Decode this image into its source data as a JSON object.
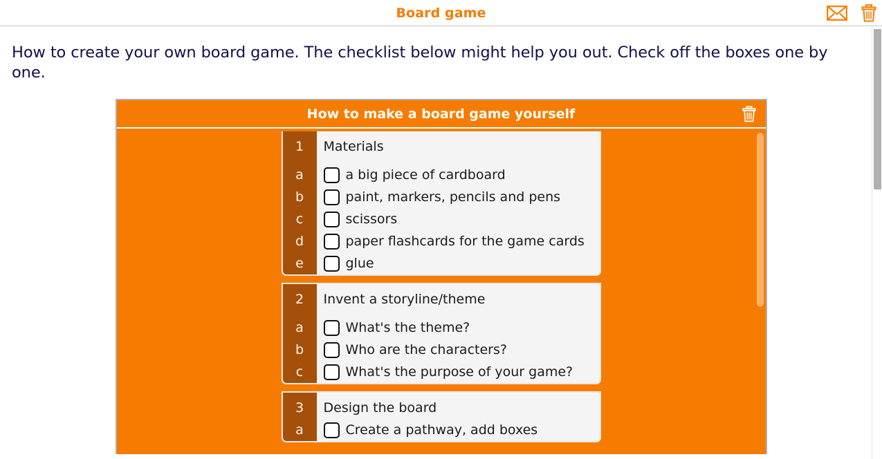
{
  "appbar": {
    "title": "Board game",
    "mail_icon": "envelope-icon",
    "trash_icon": "trash-icon",
    "accent_color": "#f57c00"
  },
  "intro": {
    "text": "How to create your own board game. The checklist below might help you out. Check off the boxes one by one.",
    "color": "#11114a"
  },
  "panel": {
    "title": "How to make a board game yourself",
    "delete_icon": "trash-icon",
    "background_color": "#f57c00",
    "gutter_color": "#a4500a",
    "card_color": "#f4f4f4",
    "sections": [
      {
        "number": "1",
        "title": "Materials",
        "items": [
          {
            "letter": "a",
            "label": "a big piece of cardboard",
            "checked": false
          },
          {
            "letter": "b",
            "label": "paint, markers, pencils and pens",
            "checked": false
          },
          {
            "letter": "c",
            "label": "scissors",
            "checked": false
          },
          {
            "letter": "d",
            "label": "paper flashcards for the game cards",
            "checked": false
          },
          {
            "letter": "e",
            "label": "glue",
            "checked": false
          }
        ]
      },
      {
        "number": "2",
        "title": "Invent a storyline/theme",
        "items": [
          {
            "letter": "a",
            "label": "What's the theme?",
            "checked": false
          },
          {
            "letter": "b",
            "label": "Who are the characters?",
            "checked": false
          },
          {
            "letter": "c",
            "label": "What's the purpose of your game?",
            "checked": false
          }
        ]
      },
      {
        "number": "3",
        "title": "Design the board",
        "items": [
          {
            "letter": "a",
            "label": "Create a pathway, add boxes",
            "checked": false
          }
        ]
      }
    ]
  }
}
